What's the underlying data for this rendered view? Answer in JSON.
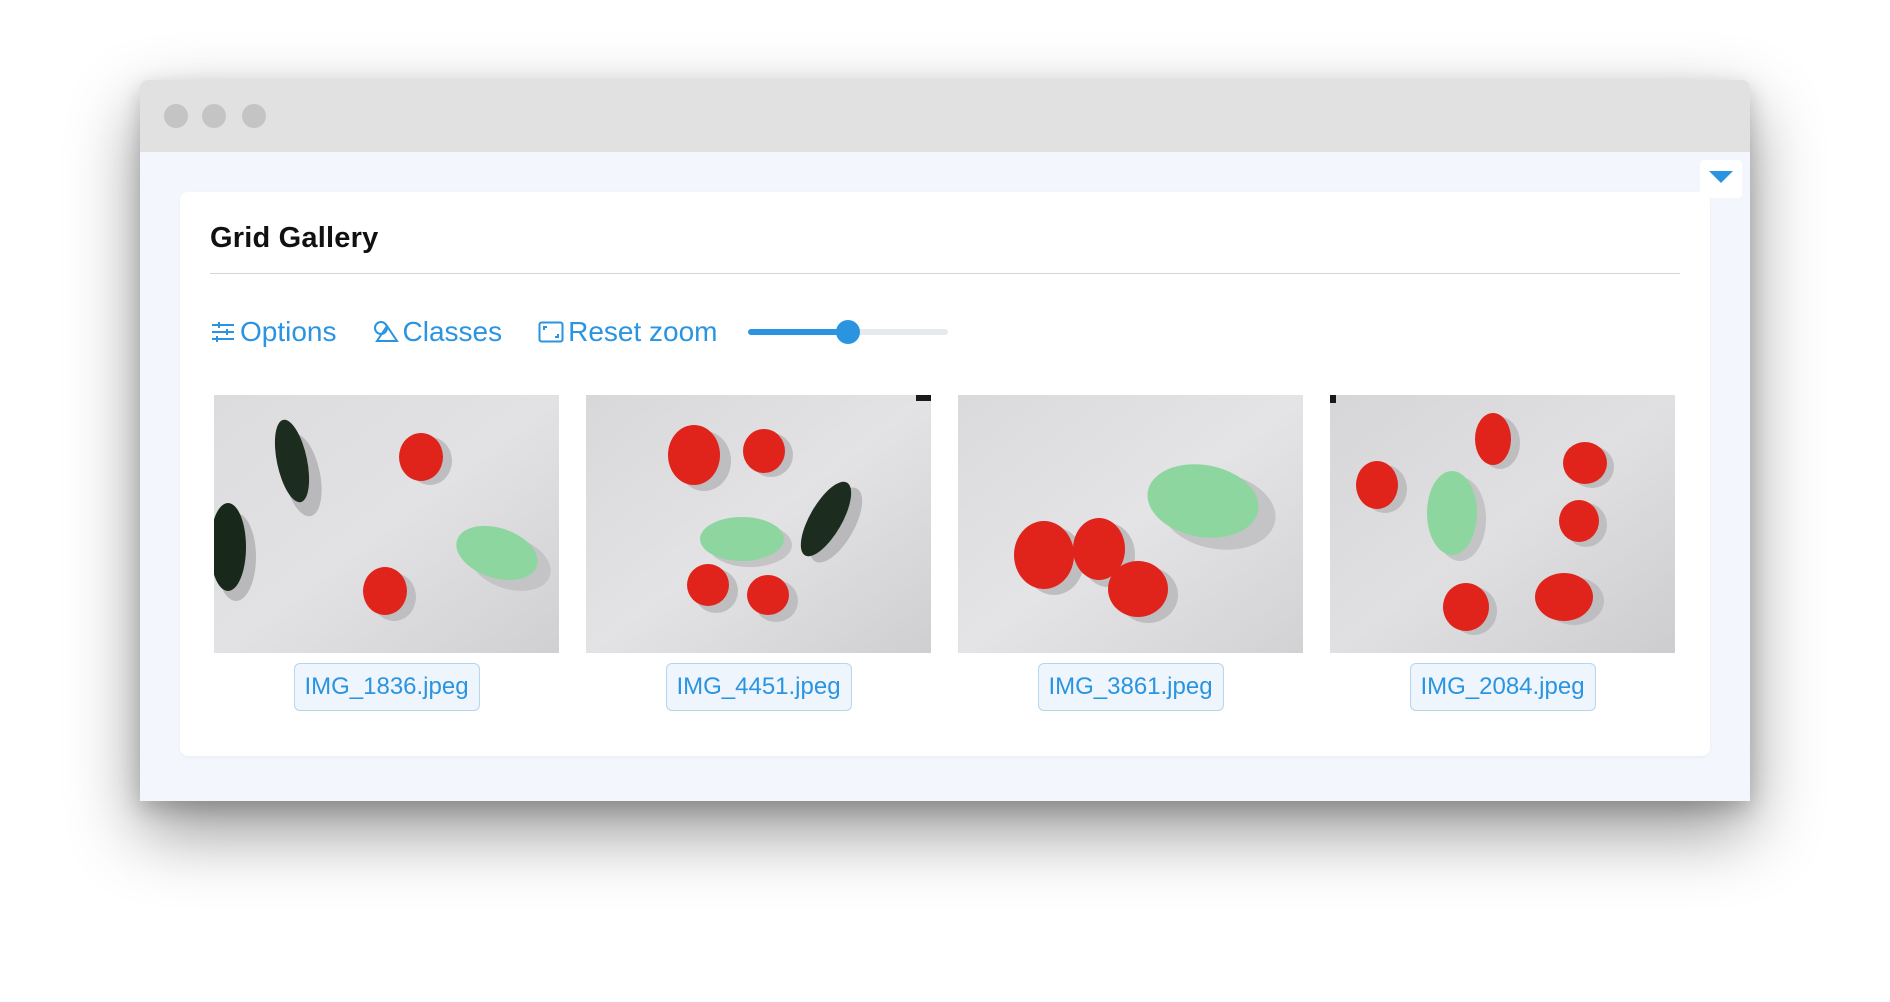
{
  "window": {
    "controls": [
      "close",
      "minimize",
      "maximize"
    ]
  },
  "panel": {
    "toggle_icon": "caret-down-icon",
    "title": "Grid Gallery"
  },
  "toolbar": {
    "options_label": "Options",
    "options_icon": "sliders-icon",
    "classes_label": "Classes",
    "classes_icon": "shapes-icon",
    "reset_zoom_label": "Reset zoom",
    "reset_zoom_icon": "frame-icon",
    "zoom_level": 0.5
  },
  "gallery": {
    "items": [
      {
        "filename": "IMG_1836.jpeg"
      },
      {
        "filename": "IMG_4451.jpeg"
      },
      {
        "filename": "IMG_3861.jpeg"
      },
      {
        "filename": "IMG_2084.jpeg"
      }
    ]
  },
  "colors": {
    "accent": "#2b94e0",
    "label_bg": "#eef5fc",
    "label_border": "#b5d4ee",
    "titlebar": "#e1e1e1",
    "panel_bg": "#f3f6fc",
    "tomato": "#e0241c",
    "lemon": "#8ed6a0",
    "cucumber": "#1c2c1e"
  }
}
